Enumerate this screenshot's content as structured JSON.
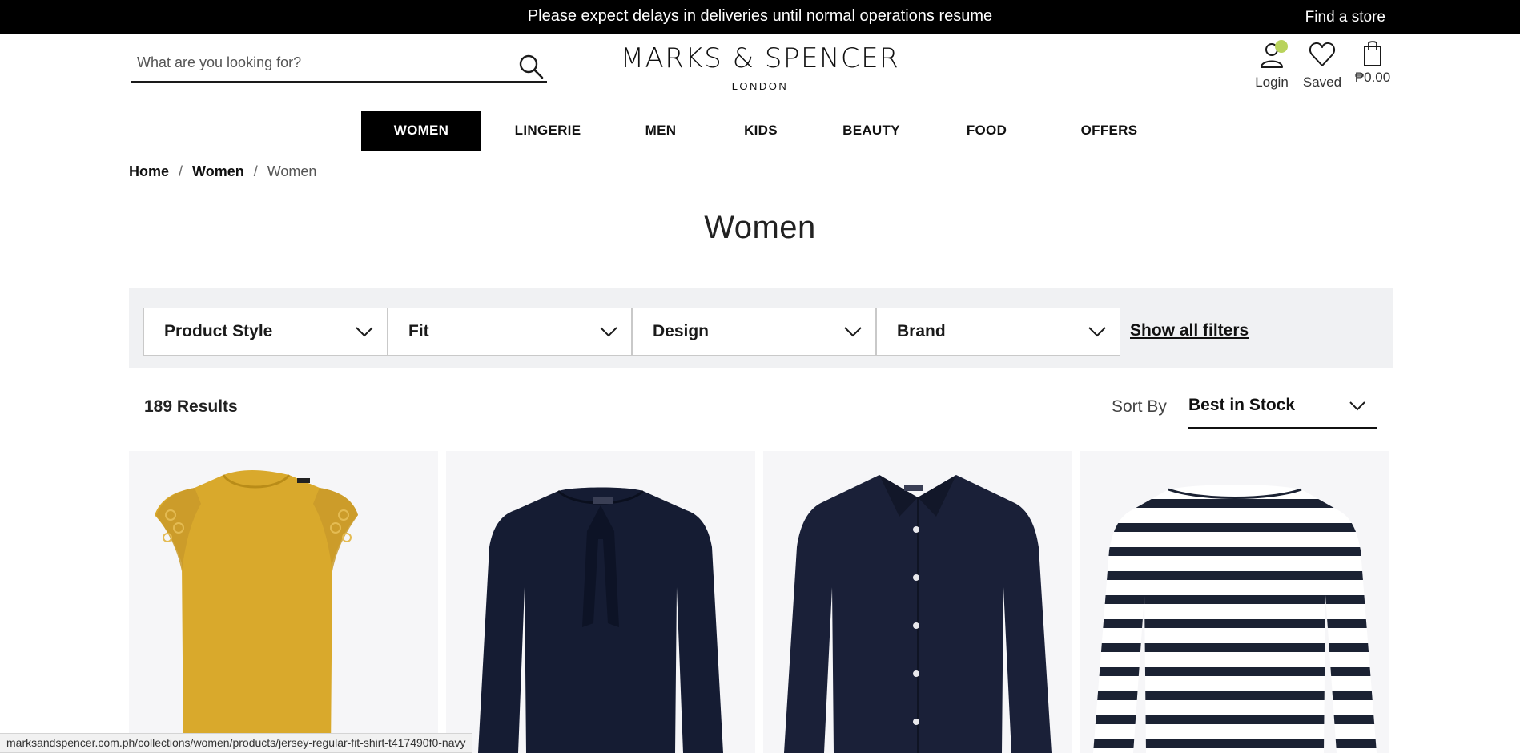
{
  "banner": {
    "message": "Please expect delays in deliveries until normal operations resume",
    "find_store": "Find a store"
  },
  "search": {
    "placeholder": "What are you looking for?",
    "value": ""
  },
  "logo": {
    "main": "MARKS & SPENCER",
    "sub": "LONDON"
  },
  "utility": {
    "login": "Login",
    "saved": "Saved",
    "bag_total": "₱0.00",
    "login_dot_color": "#b9d35c"
  },
  "nav": {
    "items": [
      {
        "label": "WOMEN",
        "active": true
      },
      {
        "label": "LINGERIE",
        "active": false
      },
      {
        "label": "MEN",
        "active": false
      },
      {
        "label": "KIDS",
        "active": false
      },
      {
        "label": "BEAUTY",
        "active": false
      },
      {
        "label": "FOOD",
        "active": false
      },
      {
        "label": "OFFERS",
        "active": false
      }
    ]
  },
  "breadcrumb": {
    "items": [
      "Home",
      "Women"
    ],
    "separator": "/",
    "current": "Women"
  },
  "page": {
    "title": "Women"
  },
  "filters": {
    "items": [
      "Product Style",
      "Fit",
      "Design",
      "Brand"
    ],
    "show_all": "Show all filters"
  },
  "results": {
    "count_text": "189 Results"
  },
  "sort": {
    "label": "Sort By",
    "value": "Best in Stock"
  },
  "products": [
    {
      "name": "mustard-lace-sleeve-top",
      "color": "#d9a92c"
    },
    {
      "name": "navy-tie-neck-blouse",
      "color": "#151c33"
    },
    {
      "name": "navy-jersey-shirt",
      "color": "#1a2038"
    },
    {
      "name": "striped-breton-top",
      "color": "#1b2233"
    }
  ],
  "statusbar": {
    "url": "marksandspencer.com.ph/collections/women/products/jersey-regular-fit-shirt-t417490f0-navy"
  },
  "colors": {
    "banner_bg": "#000000",
    "nav_active_bg": "#000000",
    "filter_bar_bg": "#f0f1f3",
    "product_bg": "#f6f6f8"
  }
}
